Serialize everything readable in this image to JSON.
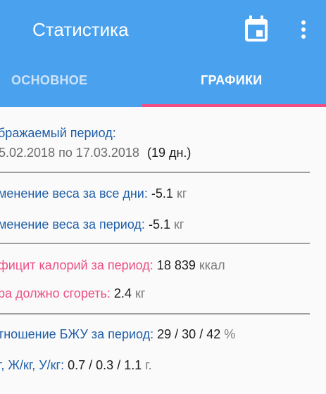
{
  "app_bar": {
    "title": "Статистика",
    "calendar_icon": "calendar-icon",
    "more_icon": "more-vert-icon",
    "color": "#4aa1ee"
  },
  "tabs": {
    "items": [
      {
        "label": "ОСНОВНОЕ",
        "selected": false
      },
      {
        "label": "ГРАФИКИ",
        "selected": true
      }
    ],
    "indicator_color": "#ef4f86"
  },
  "stats": {
    "period_label": "бражаемый период:",
    "period_dates": "5.02.2018 по 17.03.2018",
    "period_days": "(19 дн.)",
    "weight_all_label": "менение веса за все дни:",
    "weight_all_value": "-5.1",
    "weight_all_unit": "кг",
    "weight_period_label": "менение веса за период:",
    "weight_period_value": "-5.1",
    "weight_period_unit": "кг",
    "deficit_label": "фицит калорий за период:",
    "deficit_value": "18 839",
    "deficit_unit": "ккал",
    "fat_burn_label": "ра должно сгореть:",
    "fat_burn_value": "2.4",
    "fat_burn_unit": "кг",
    "bju_label": "тношение БЖУ за период:",
    "bju_value": "29 / 30 / 42",
    "bju_unit": "%",
    "bju_per_kg_label": "г, Ж/кг, У/кг:",
    "bju_per_kg_value": "0.7 / 0.3 / 1.1",
    "bju_per_kg_unit": "г."
  }
}
